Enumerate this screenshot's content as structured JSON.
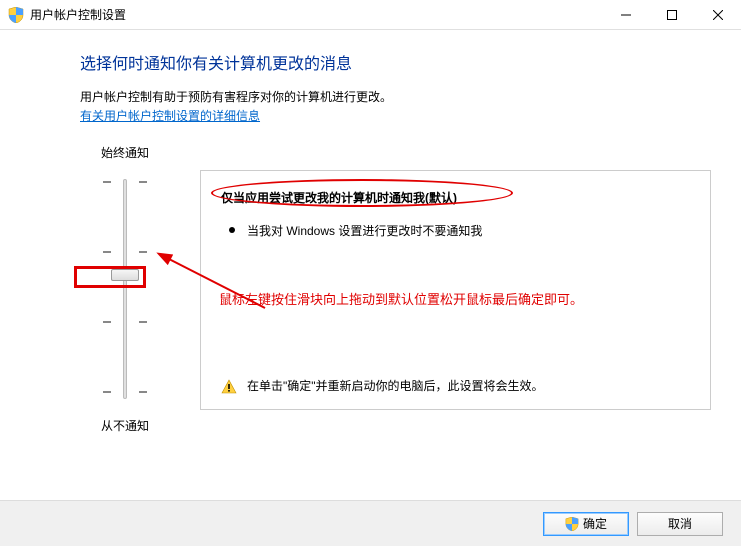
{
  "titlebar": {
    "title": "用户帐户控制设置"
  },
  "content": {
    "heading": "选择何时通知你有关计算机更改的消息",
    "desc": "用户帐户控制有助于预防有害程序对你的计算机进行更改。",
    "link": "有关用户帐户控制设置的详细信息"
  },
  "slider": {
    "label_top": "始终通知",
    "label_bottom": "从不通知"
  },
  "info": {
    "title": "仅当应用尝试更改我的计算机时通知我(默认)",
    "bullet1": "当我对 Windows 设置进行更改时不要通知我",
    "warning": "在单击\"确定\"并重新启动你的电脑后，此设置将会生效。"
  },
  "annotation": {
    "text": "鼠标左键按住滑块向上拖动到默认位置松开鼠标最后确定即可。"
  },
  "footer": {
    "ok": "确定",
    "cancel": "取消"
  }
}
